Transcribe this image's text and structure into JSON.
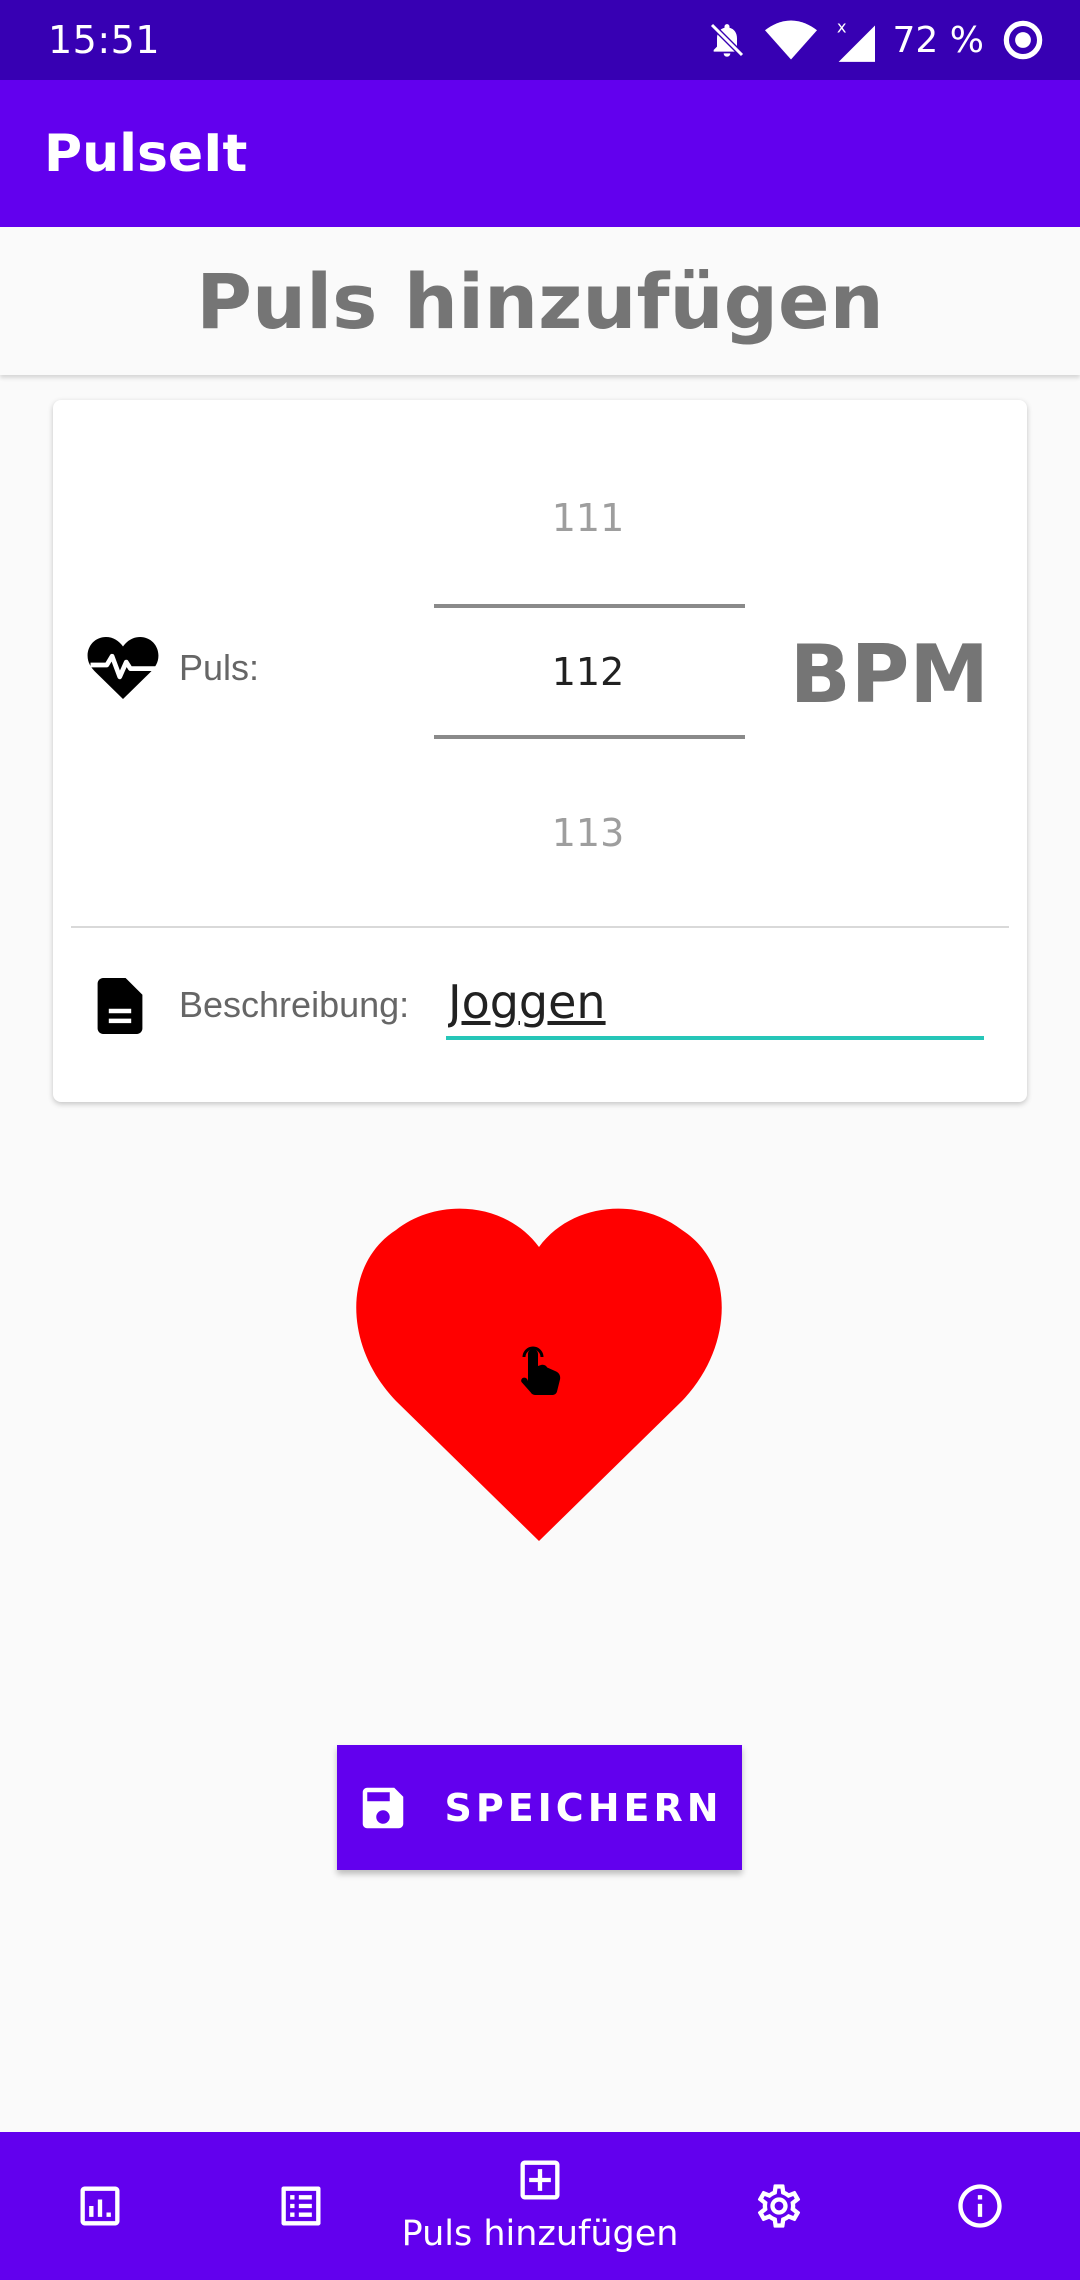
{
  "status_bar": {
    "time": "15:51",
    "battery": "72 %"
  },
  "app_bar": {
    "title": "PulseIt"
  },
  "page": {
    "title": "Puls hinzufügen"
  },
  "pulse": {
    "label": "Puls:",
    "picker_prev": "111",
    "picker_current": "112",
    "picker_next": "113",
    "unit": "BPM"
  },
  "description": {
    "label": "Beschreibung:",
    "value": "Joggen"
  },
  "save_button": {
    "label": "SPEICHERN"
  },
  "bottom_nav": {
    "items": [
      {
        "icon": "chart-icon"
      },
      {
        "icon": "list-icon"
      },
      {
        "icon": "add-box-icon",
        "label": "Puls hinzufügen"
      },
      {
        "icon": "gear-icon"
      },
      {
        "icon": "info-icon"
      }
    ]
  },
  "colors": {
    "status_bar": "#3700b3",
    "primary": "#6200ee",
    "heart": "#ff0000",
    "input_underline": "#26c6b8"
  }
}
